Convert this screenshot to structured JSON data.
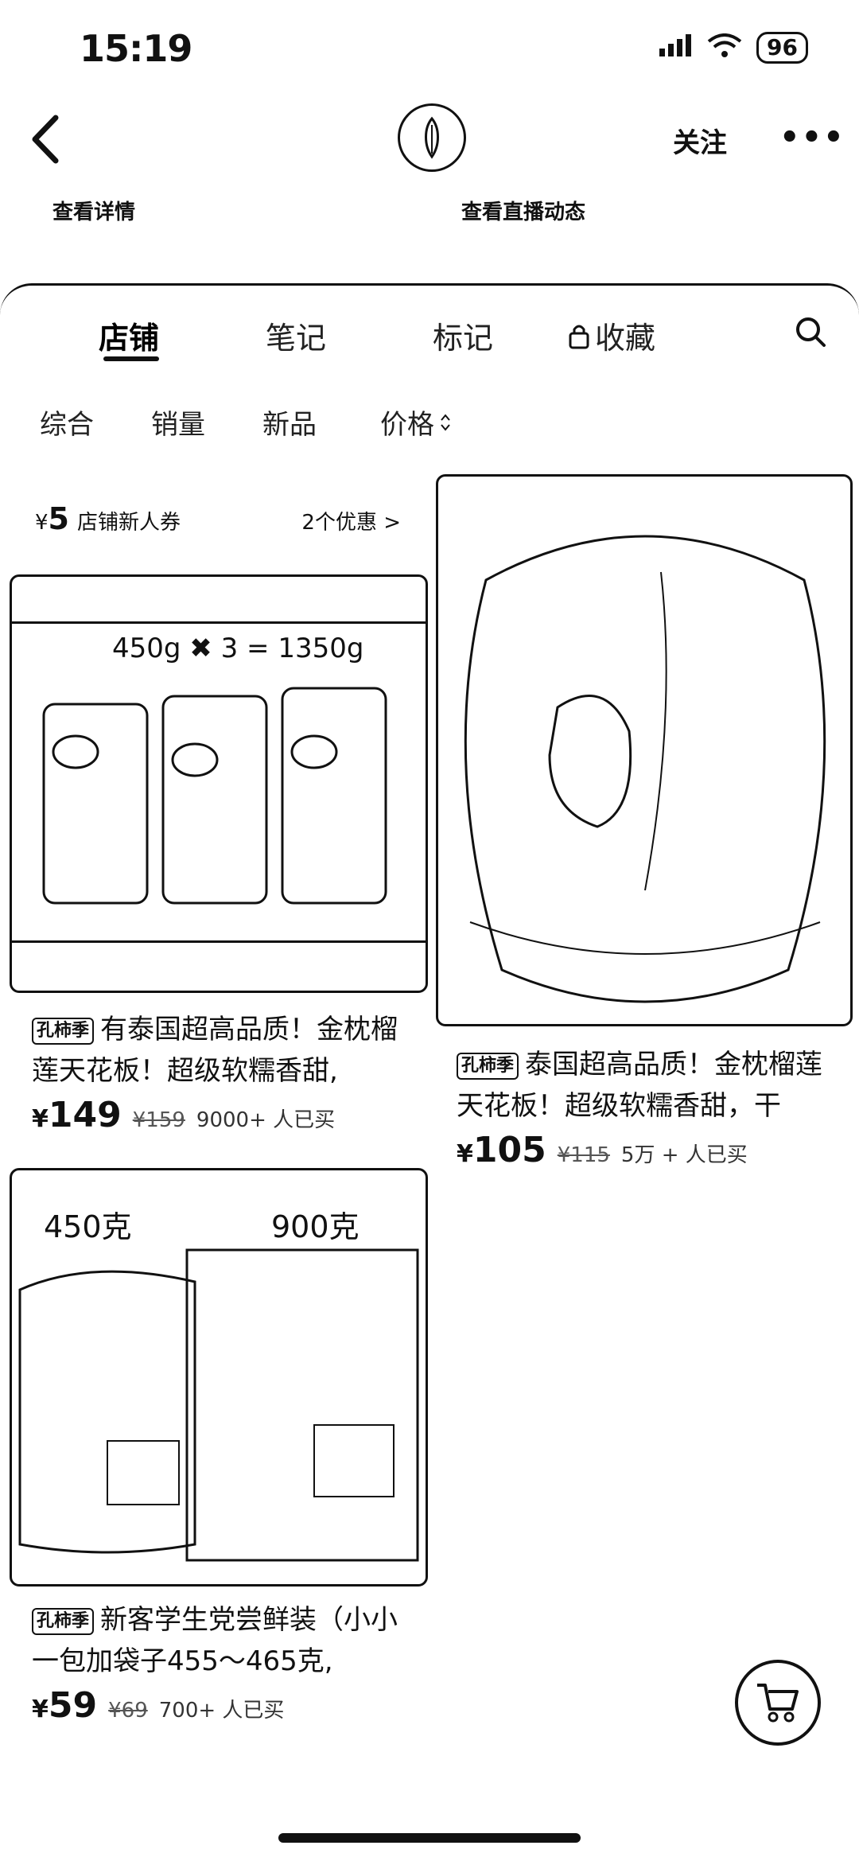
{
  "status": {
    "time": "15:19",
    "battery": "96"
  },
  "header": {
    "follow_label": "关注",
    "more_label": "•••",
    "left_sub": "查看详情",
    "right_sub": "查看直播动态"
  },
  "tabs": [
    {
      "label": "店铺"
    },
    {
      "label": "笔记"
    },
    {
      "label": "标记"
    },
    {
      "label": "收藏"
    }
  ],
  "filters": [
    "综合",
    "销量",
    "新品",
    "价格"
  ],
  "coupon": {
    "currency": "¥",
    "amount": "5",
    "label": "店铺新人券",
    "more": "2个优惠 >"
  },
  "products": [
    {
      "tag": "孔柿季",
      "title": "有泰国超高品质！金枕榴莲天花板！超级软糯香甜,",
      "currency": "¥",
      "price": "149",
      "old_price": "¥159",
      "sold": "9000+ 人已买",
      "image_text": "450g ✖ 3 = 1350g"
    },
    {
      "tag": "孔柿季",
      "title": "泰国超高品质！金枕榴莲天花板！超级软糯香甜，干",
      "currency": "¥",
      "price": "105",
      "old_price": "¥115",
      "sold": "5万 + 人已买"
    },
    {
      "tag": "孔柿季",
      "title": "新客学生党尝鲜装（小小一包加袋子455～465克,",
      "currency": "¥",
      "price": "59",
      "old_price": "¥69",
      "sold": "700+ 人已买",
      "image_text_a": "450克",
      "image_text_b": "900克"
    }
  ]
}
